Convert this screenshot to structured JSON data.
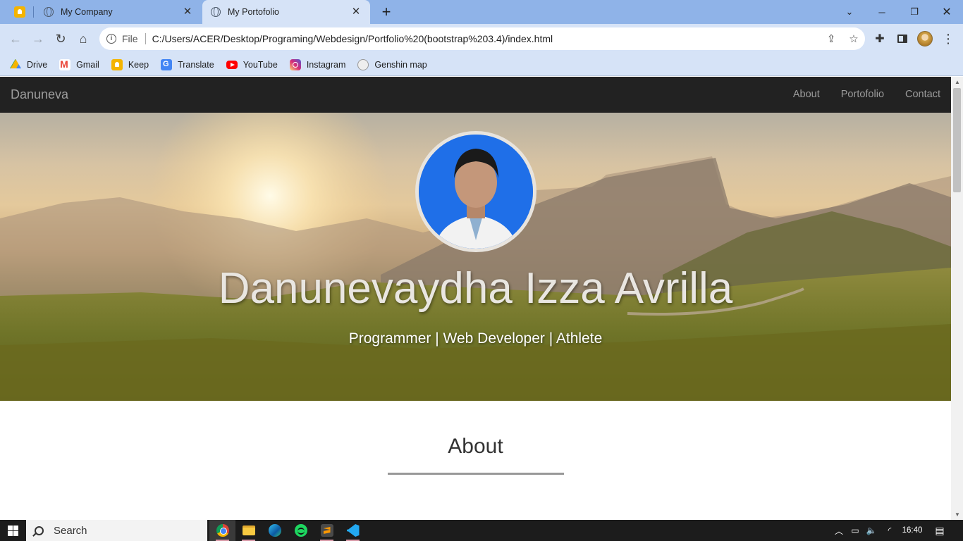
{
  "browser": {
    "tabs": [
      {
        "title": "My Company",
        "active": false
      },
      {
        "title": "My Portofolio",
        "active": true
      }
    ],
    "new_tab_symbol": "+",
    "address": {
      "scheme_label": "File",
      "url": "C:/Users/ACER/Desktop/Programing/Webdesign/Portfolio%20(bootstrap%203.4)/index.html"
    },
    "bookmarks": [
      {
        "label": "Drive",
        "icon": "drive-icon"
      },
      {
        "label": "Gmail",
        "icon": "gmail-icon"
      },
      {
        "label": "Keep",
        "icon": "keep-icon"
      },
      {
        "label": "Translate",
        "icon": "translate-icon"
      },
      {
        "label": "YouTube",
        "icon": "youtube-icon"
      },
      {
        "label": "Instagram",
        "icon": "instagram-icon"
      },
      {
        "label": "Genshin map",
        "icon": "genshin-map-icon"
      }
    ]
  },
  "site": {
    "brand": "Danuneva",
    "nav": [
      "About",
      "Portofolio",
      "Contact"
    ],
    "hero": {
      "name": "Danunevaydha Izza Avrilla",
      "tagline": "Programmer | Web Developer | Athlete"
    },
    "about": {
      "title": "About"
    },
    "colors": {
      "navbar": "#222222",
      "nav_text": "#9d9d9d",
      "avatar_bg": "#1f6fe8"
    }
  },
  "taskbar": {
    "search_placeholder": "Search",
    "apps": [
      "chrome-icon",
      "file-explorer-icon",
      "edge-icon",
      "spotify-icon",
      "sublime-text-icon",
      "vscode-icon"
    ],
    "clock": "16:40"
  }
}
